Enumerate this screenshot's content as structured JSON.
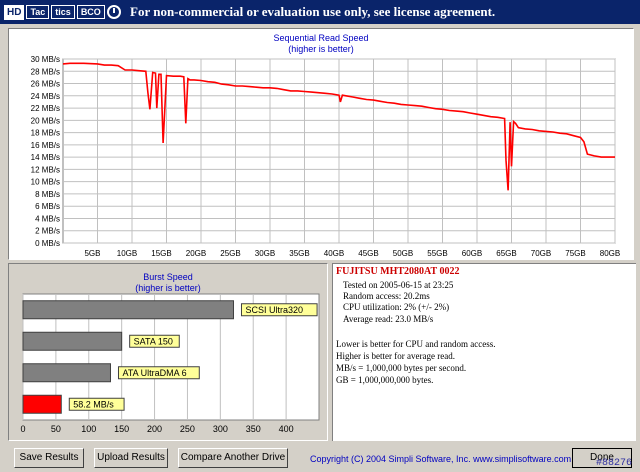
{
  "window": {
    "logo_text": "HD",
    "logo_segments": [
      "Tac",
      "tics",
      "BCO"
    ],
    "title": "For non-commercial or evaluation use only, see license agreement."
  },
  "chart_data": [
    {
      "type": "line",
      "title": "Sequential Read Speed",
      "subtitle": "(higher is better)",
      "ylim": [
        0,
        30
      ],
      "xlim": [
        0,
        80
      ],
      "y_ticks": [
        0,
        2,
        4,
        6,
        8,
        10,
        12,
        14,
        16,
        18,
        20,
        22,
        24,
        26,
        28,
        30
      ],
      "y_tick_labels": [
        "0 MB/s",
        "2 MB/s",
        "4 MB/s",
        "6 MB/s",
        "8 MB/s",
        "10 MB/s",
        "12 MB/s",
        "14 MB/s",
        "16 MB/s",
        "18 MB/s",
        "20 MB/s",
        "22 MB/s",
        "24 MB/s",
        "26 MB/s",
        "28 MB/s",
        "30 MB/s"
      ],
      "x_ticks": [
        5,
        10,
        15,
        20,
        25,
        30,
        35,
        40,
        45,
        50,
        55,
        60,
        65,
        70,
        75,
        80
      ],
      "x_tick_labels": [
        "5GB",
        "10GB",
        "15GB",
        "20GB",
        "25GB",
        "30GB",
        "35GB",
        "40GB",
        "45GB",
        "50GB",
        "55GB",
        "60GB",
        "65GB",
        "70GB",
        "75GB",
        "80GB"
      ],
      "grid": true,
      "series": [
        {
          "color": "#ff0000",
          "x": [
            0,
            1,
            3,
            5,
            6,
            7,
            8,
            9,
            10,
            11,
            12,
            12.3,
            12.6,
            13,
            13.4,
            13.6,
            13.9,
            14.2,
            14.5,
            15,
            16,
            17,
            17.5,
            17.8,
            18.1,
            18.4,
            19,
            20,
            21,
            22,
            23,
            24,
            25,
            26,
            27,
            28,
            29,
            30,
            31,
            32,
            33,
            34,
            35,
            36,
            37,
            38,
            39,
            40,
            40.2,
            40.5,
            41,
            42,
            43,
            44,
            45,
            46,
            47,
            48,
            49,
            50,
            51,
            52,
            53,
            54,
            55,
            56,
            57,
            58,
            59,
            60,
            61,
            62,
            63,
            64,
            64.2,
            64.5,
            64.8,
            65,
            65.3,
            65.6,
            66,
            67,
            68,
            69,
            70,
            71,
            72,
            73,
            74,
            75,
            75.5,
            76,
            77,
            78,
            79,
            80
          ],
          "y": [
            29.2,
            29.3,
            29.3,
            29.2,
            29.0,
            29.0,
            28.9,
            28.2,
            28.2,
            28.1,
            28.0,
            24.5,
            21.8,
            27.8,
            27.7,
            22.0,
            27.5,
            27.5,
            16.3,
            27.3,
            27.2,
            27.2,
            27.1,
            19.5,
            26.8,
            26.6,
            26.6,
            26.5,
            26.3,
            26.2,
            25.9,
            25.8,
            25.6,
            25.6,
            25.5,
            25.4,
            25.3,
            25.3,
            25.2,
            25.0,
            24.8,
            24.8,
            24.7,
            24.6,
            24.5,
            24.4,
            24.3,
            24.1,
            23.0,
            24.1,
            24.0,
            23.8,
            23.6,
            23.4,
            23.3,
            23.1,
            22.9,
            22.8,
            22.6,
            22.5,
            22.4,
            22.3,
            22.1,
            21.9,
            21.8,
            21.6,
            21.5,
            21.4,
            21.2,
            21.0,
            20.8,
            20.6,
            20.5,
            20.3,
            13.5,
            8.6,
            19.7,
            12.5,
            19.8,
            19.5,
            18.8,
            18.6,
            18.5,
            18.3,
            18.2,
            18.1,
            17.9,
            17.8,
            17.5,
            17.2,
            16.5,
            14.5,
            14.2,
            14.0,
            14.0,
            14.0
          ]
        }
      ]
    },
    {
      "type": "bar",
      "title": "Burst Speed",
      "subtitle": "(higher is better)",
      "xlim": [
        0,
        450
      ],
      "x_ticks": [
        0,
        50,
        100,
        150,
        200,
        250,
        300,
        350,
        400
      ],
      "x_tick_labels": [
        "0",
        "50",
        "100",
        "150",
        "200",
        "250",
        "300",
        "350",
        "400"
      ],
      "grid": true,
      "bars": [
        {
          "label": "SCSI Ultra320",
          "value": 320,
          "color": "#808080"
        },
        {
          "label": "SATA 150",
          "value": 150,
          "color": "#808080"
        },
        {
          "label": "ATA UltraDMA 6",
          "value": 133,
          "color": "#808080"
        },
        {
          "label": "58.2 MB/s",
          "value": 58.2,
          "color": "#ff0000"
        }
      ]
    }
  ],
  "info": {
    "drive": "FUJITSU MHT2080AT 0022",
    "tested": "Tested on 2005-06-15 at 23:25",
    "random_access": "Random access: 20.2ms",
    "cpu": "CPU utilization: 2% (+/- 2%)",
    "average_read": "Average read: 23.0 MB/s",
    "notes": [
      "Lower is better for CPU and random access.",
      "Higher is better for average read.",
      "MB/s = 1,000,000 bytes per second.",
      "GB = 1,000,000,000 bytes."
    ]
  },
  "buttons": {
    "save": "Save Results",
    "upload": "Upload Results",
    "compare": "Compare Another Drive",
    "done": "Done"
  },
  "footer": {
    "copyright": "Copyright (C) 2004 Simpli Software, Inc. www.simplisoftware.com",
    "watermark": "#88276"
  }
}
